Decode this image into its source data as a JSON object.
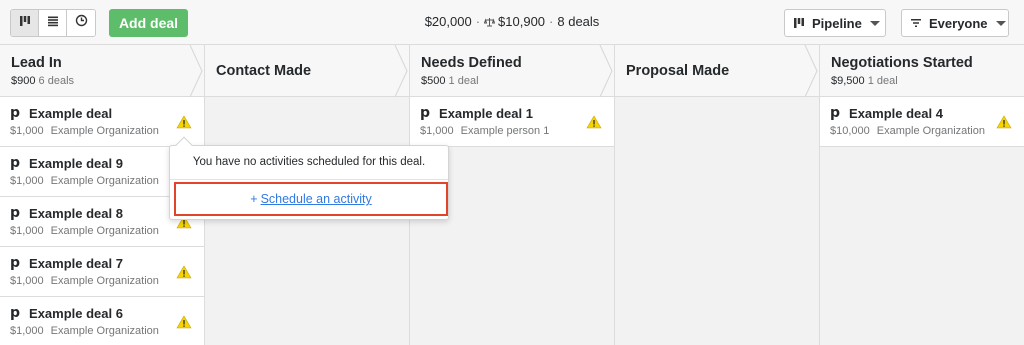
{
  "toolbar": {
    "add_deal_label": "Add deal",
    "summary": {
      "total": "$20,000",
      "weighted": "$10,900",
      "deals": "8 deals"
    },
    "pipeline_label": "Pipeline",
    "owner_filter_label": "Everyone"
  },
  "stages": [
    {
      "name": "Lead In",
      "value": "$900",
      "count": "6 deals"
    },
    {
      "name": "Contact Made"
    },
    {
      "name": "Needs Defined",
      "value": "$500",
      "count": "1 deal"
    },
    {
      "name": "Proposal Made"
    },
    {
      "name": "Negotiations Started",
      "value": "$9,500",
      "count": "1 deal"
    }
  ],
  "deals": {
    "lead_in": [
      {
        "title": "Example deal",
        "value": "$1,000",
        "org": "Example Organization"
      },
      {
        "title": "Example deal 9",
        "value": "$1,000",
        "org": "Example Organization"
      },
      {
        "title": "Example deal 8",
        "value": "$1,000",
        "org": "Example Organization"
      },
      {
        "title": "Example deal 7",
        "value": "$1,000",
        "org": "Example Organization"
      },
      {
        "title": "Example deal 6",
        "value": "$1,000",
        "org": "Example Organization"
      }
    ],
    "needs_defined": [
      {
        "title": "Example deal 1",
        "value": "$1,000",
        "org": "Example person 1"
      }
    ],
    "negotiations_started": [
      {
        "title": "Example deal 4",
        "value": "$10,000",
        "org": "Example Organization"
      }
    ]
  },
  "popover": {
    "message": "You have no activities scheduled for this deal.",
    "plus": "+",
    "schedule_label": "Schedule an activity"
  },
  "colors": {
    "accent_green": "#5ebd6a",
    "link_blue": "#317ae2",
    "highlight_red": "#e0452c",
    "warning_yellow": "#f5d400"
  },
  "icons": [
    "kanban-icon",
    "list-icon",
    "forecast-icon",
    "scale-icon",
    "pipedrive-p-icon",
    "warning-icon",
    "filter-icon",
    "chevron-arrow-icon"
  ]
}
